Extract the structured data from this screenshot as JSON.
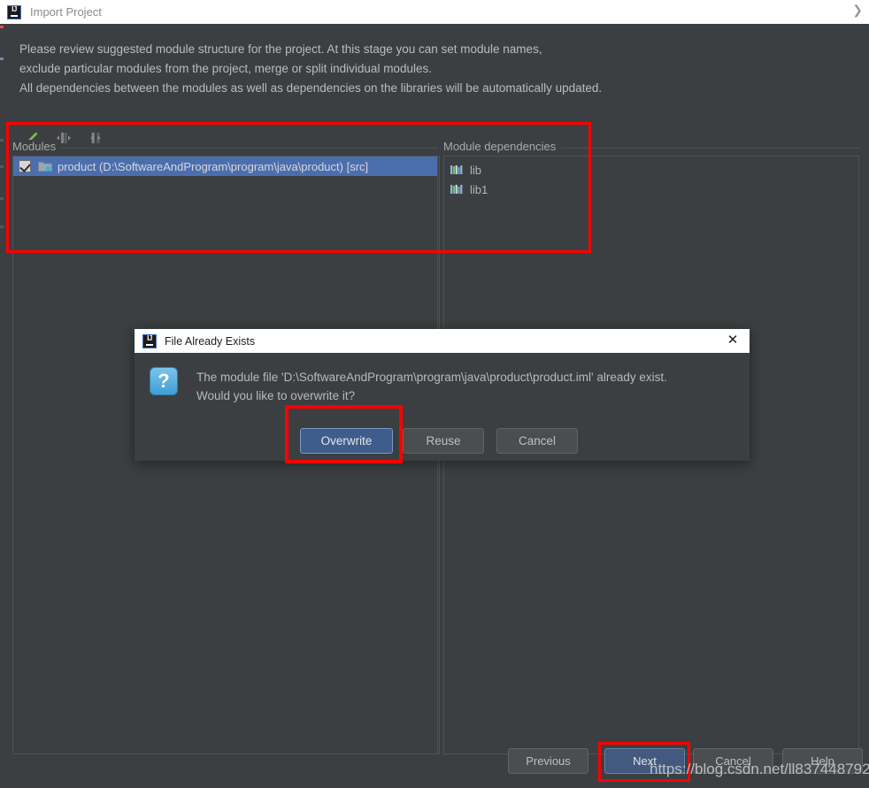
{
  "window": {
    "title": "Import Project",
    "logo_icon": "intellij-idea-icon",
    "chevron_icon": "chevron-right-icon"
  },
  "wizard": {
    "description_lines": [
      "Please review suggested module structure for the project. At this stage you can set module names,",
      "exclude particular modules from the project, merge or split individual modules.",
      "All dependencies between the modules as well as dependencies on the libraries will be automatically updated."
    ],
    "toolbar": [
      {
        "name": "edit-pencil-icon",
        "label": "Edit"
      },
      {
        "name": "merge-modules-icon",
        "label": "Merge"
      },
      {
        "name": "split-module-icon",
        "label": "Split"
      }
    ],
    "modules_panel": {
      "label": "Modules",
      "rows": [
        {
          "checked": true,
          "folder_icon": "module-folder-icon",
          "label": "product (D:\\SoftwareAndProgram\\program\\java\\product) [src]",
          "selected": true
        }
      ]
    },
    "dependencies_panel": {
      "label": "Module dependencies",
      "rows": [
        {
          "icon": "library-icon",
          "label": "lib"
        },
        {
          "icon": "library-icon",
          "label": "lib1"
        }
      ]
    },
    "buttons": {
      "previous": {
        "label": "Previous",
        "mnemonic": "P"
      },
      "next": {
        "label": "Next",
        "mnemonic": "N",
        "primary": true
      },
      "cancel": {
        "label": "Cancel"
      },
      "help": {
        "label": "Help"
      }
    }
  },
  "dialog": {
    "logo_icon": "intellij-idea-icon",
    "title": "File Already Exists",
    "close_icon": "close-icon",
    "question_icon": "question-mark-icon",
    "message_lines": [
      "The module file 'D:\\SoftwareAndProgram\\program\\java\\product\\product.iml' already exist.",
      "Would you like to overwrite it?"
    ],
    "buttons": {
      "overwrite": {
        "label": "Overwrite",
        "primary": true
      },
      "reuse": {
        "label": "Reuse"
      },
      "cancel": {
        "label": "Cancel"
      }
    }
  },
  "annotations": {
    "highlight_color": "#fe0000",
    "watermark": "https://blog.csdn.net/ll837448792"
  },
  "theme": {
    "background": "#3c3f41",
    "titlebar_background": "#ffffff",
    "selection_blue": "#4b6eaf",
    "text": "#bbbbbb",
    "border": "#4f5254"
  }
}
